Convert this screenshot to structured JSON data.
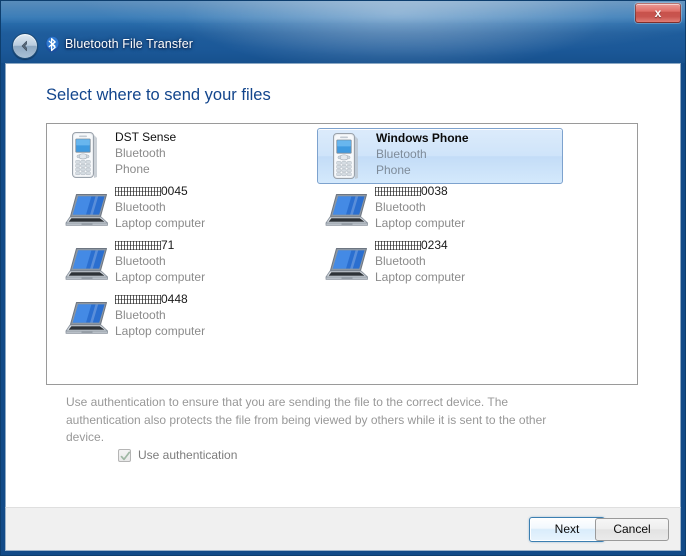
{
  "window": {
    "title": "Bluetooth File Transfer",
    "back_icon": "back-arrow-icon",
    "app_icon": "bluetooth-icon",
    "close_label": "x",
    "accent_color": "#1f5d9c",
    "heading_color": "#12458c"
  },
  "page": {
    "heading": "Select where to send your files"
  },
  "devices": [
    {
      "name": "DST Sense",
      "name_redacted": false,
      "transport": "Bluetooth",
      "kind": "Phone",
      "icon": "phone-icon",
      "selected": false,
      "col": 0,
      "row": 0
    },
    {
      "name": "Windows Phone",
      "name_redacted": false,
      "transport": "Bluetooth",
      "kind": "Phone",
      "icon": "phone-icon",
      "selected": true,
      "col": 1,
      "row": 0
    },
    {
      "name_prefix_masked": "I3TWCN",
      "name_suffix": "0045",
      "name_redacted": true,
      "transport": "Bluetooth",
      "kind": "Laptop computer",
      "icon": "laptop-icon",
      "selected": false,
      "col": 0,
      "row": 1
    },
    {
      "name_prefix_masked": "I3TWCN",
      "name_suffix": "0038",
      "name_redacted": true,
      "transport": "Bluetooth",
      "kind": "Laptop computer",
      "icon": "laptop-icon",
      "selected": false,
      "col": 1,
      "row": 1
    },
    {
      "name_prefix_masked": "I3TWCN",
      "name_suffix": "71",
      "name_redacted": true,
      "transport": "Bluetooth",
      "kind": "Laptop computer",
      "icon": "laptop-icon",
      "selected": false,
      "col": 0,
      "row": 2
    },
    {
      "name_prefix_masked": "I3TWCN",
      "name_suffix": "0234",
      "name_redacted": true,
      "transport": "Bluetooth",
      "kind": "Laptop computer",
      "icon": "laptop-icon",
      "selected": false,
      "col": 1,
      "row": 2
    },
    {
      "name_prefix_masked": "I3TWCN",
      "name_suffix": "0448",
      "name_redacted": true,
      "transport": "Bluetooth",
      "kind": "Laptop computer",
      "icon": "laptop-icon",
      "selected": false,
      "col": 0,
      "row": 3
    }
  ],
  "auth": {
    "note": "Use authentication to ensure that you are sending the file to the correct device. The authentication also protects the file from being viewed by others while it is sent to the other device.",
    "checkbox_label": "Use authentication",
    "checked": true,
    "enabled": false
  },
  "footer": {
    "next_label": "Next",
    "cancel_label": "Cancel"
  }
}
